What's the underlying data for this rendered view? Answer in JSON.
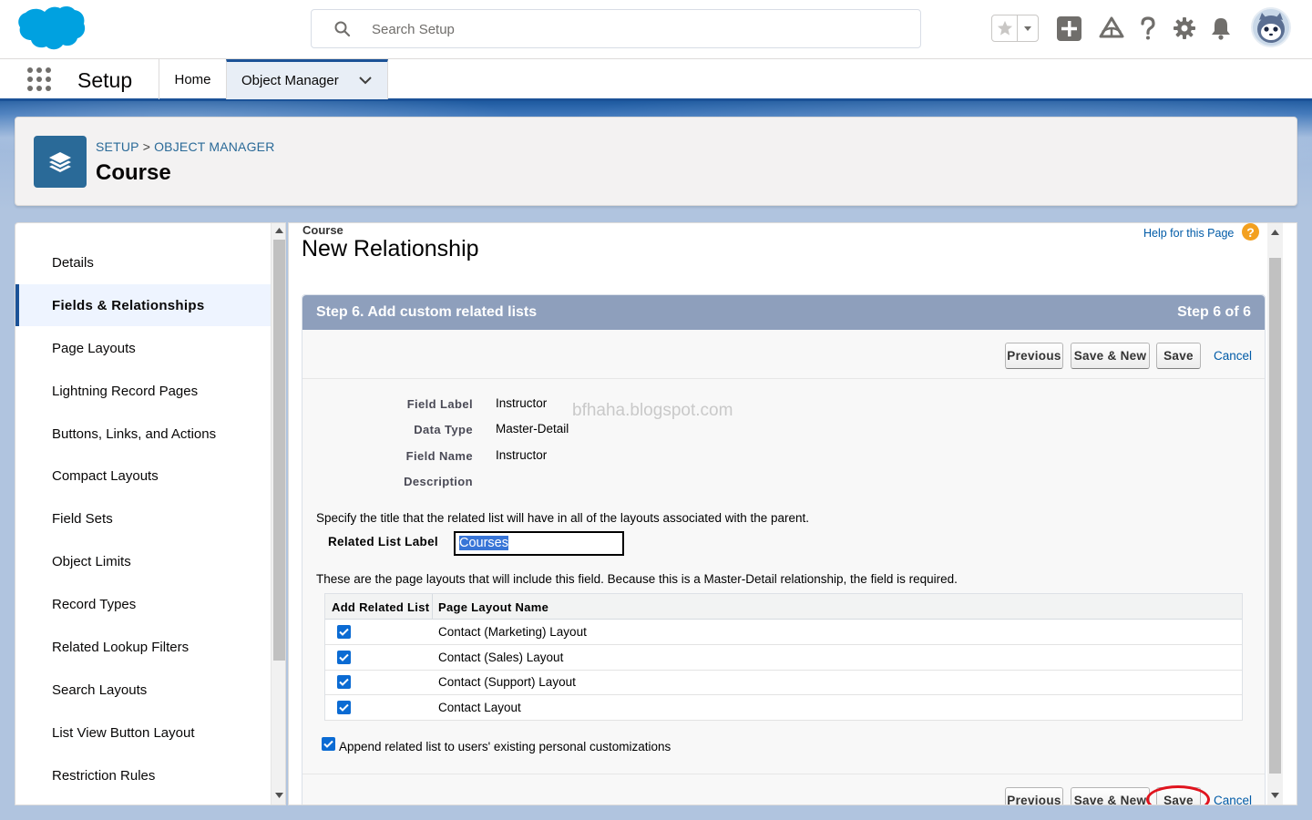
{
  "header": {
    "search_placeholder": "Search Setup",
    "icons": [
      "salesforce-logo",
      "search-icon",
      "favorites-star-icon",
      "favorites-dropdown-icon",
      "add-icon",
      "trailhead-icon",
      "help-icon",
      "gear-icon",
      "bell-icon",
      "avatar"
    ]
  },
  "context_bar": {
    "app_name": "Setup",
    "tabs": [
      {
        "label": "Home"
      },
      {
        "label": "Object Manager"
      }
    ]
  },
  "object_header": {
    "breadcrumb_setup": "SETUP",
    "breadcrumb_separator": ">",
    "breadcrumb_object_manager": "OBJECT MANAGER",
    "title": "Course"
  },
  "sidebar": {
    "items": [
      {
        "label": "Details"
      },
      {
        "label": "Fields & Relationships",
        "active": true
      },
      {
        "label": "Page Layouts"
      },
      {
        "label": "Lightning Record Pages"
      },
      {
        "label": "Buttons, Links, and Actions"
      },
      {
        "label": "Compact Layouts"
      },
      {
        "label": "Field Sets"
      },
      {
        "label": "Object Limits"
      },
      {
        "label": "Record Types"
      },
      {
        "label": "Related Lookup Filters"
      },
      {
        "label": "Search Layouts"
      },
      {
        "label": "List View Button Layout"
      },
      {
        "label": "Restriction Rules"
      }
    ]
  },
  "page": {
    "type": "Course",
    "title": "New Relationship",
    "help_link": "Help for this Page",
    "help_icon": "?",
    "step_title": "Step 6. Add custom related lists",
    "step_number": "Step 6 of 6",
    "buttons": {
      "previous": "Previous",
      "save_new": "Save & New",
      "save": "Save",
      "cancel": "Cancel"
    },
    "details": [
      {
        "label": "Field Label",
        "value": "Instructor"
      },
      {
        "label": "Data Type",
        "value": "Master-Detail"
      },
      {
        "label": "Field Name",
        "value": "Instructor"
      },
      {
        "label": "Description",
        "value": ""
      }
    ],
    "watermark": "bfhaha.blogspot.com",
    "title_instruction": "Specify the title that the related list will have in all of the layouts associated with the parent.",
    "related_list_label": "Related List Label",
    "related_list_value": "Courses",
    "layouts_instruction": "These are the page layouts that will include this field. Because this is a Master-Detail relationship, the field is required.",
    "table_headers": [
      "Add Related List",
      "Page Layout Name"
    ],
    "layouts": [
      {
        "checked": true,
        "name": "Contact (Marketing) Layout"
      },
      {
        "checked": true,
        "name": "Contact (Sales) Layout"
      },
      {
        "checked": true,
        "name": "Contact (Support) Layout"
      },
      {
        "checked": true,
        "name": "Contact Layout"
      }
    ],
    "append_checked": true,
    "append_label": "Append related list to users' existing personal customizations"
  },
  "colors": {
    "brand": "#1b5297",
    "step_header": "#8e9fbc",
    "link": "#015ba7",
    "checkbox": "#0b6bd3",
    "highlight_oval": "#e0141e"
  }
}
